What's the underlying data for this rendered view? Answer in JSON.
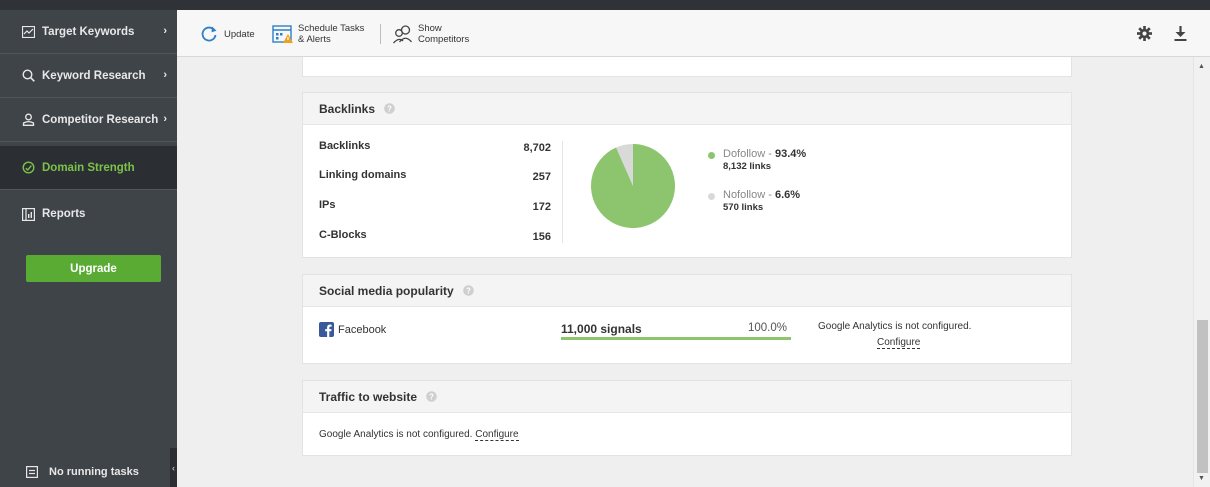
{
  "sidebar": {
    "items": [
      {
        "label": "Target Keywords",
        "icon": "line-chart-icon"
      },
      {
        "label": "Keyword Research",
        "icon": "search-icon"
      },
      {
        "label": "Competitor Research",
        "icon": "user-icon"
      },
      {
        "label": "Domain Strength",
        "icon": "gauge-icon"
      },
      {
        "label": "Reports",
        "icon": "report-icon"
      }
    ],
    "upgrade_label": "Upgrade",
    "tasks_label": "No running tasks"
  },
  "toolbar": {
    "update_label": "Update",
    "schedule_line1": "Schedule Tasks",
    "schedule_line2": "& Alerts",
    "competitors_line1": "Show",
    "competitors_line2": "Competitors"
  },
  "backlinks": {
    "title": "Backlinks",
    "rows": [
      {
        "label": "Backlinks",
        "value": "8,702"
      },
      {
        "label": "Linking domains",
        "value": "257"
      },
      {
        "label": "IPs",
        "value": "172"
      },
      {
        "label": "C-Blocks",
        "value": "156"
      }
    ],
    "legend": [
      {
        "name": "Dofollow",
        "pct": "93.4%",
        "sub": "8,132 links",
        "color": "#8cc56e"
      },
      {
        "name": "Nofollow",
        "pct": "6.6%",
        "sub": "570 links",
        "color": "#d9d9d9"
      }
    ]
  },
  "chart_data": {
    "type": "pie",
    "categories": [
      "Dofollow",
      "Nofollow"
    ],
    "values": [
      93.4,
      6.6
    ]
  },
  "social": {
    "title": "Social media popularity",
    "network": "Facebook",
    "signals": "11,000 signals",
    "percent": "100.0%",
    "fill": 1.0,
    "ga_note": "Google Analytics is not configured.",
    "configure": "Configure"
  },
  "traffic": {
    "title": "Traffic to website",
    "text": "Google Analytics is not configured.",
    "configure": "Configure"
  },
  "colors": {
    "accent": "#5aab33",
    "sidebar_bg": "#3f4449"
  }
}
